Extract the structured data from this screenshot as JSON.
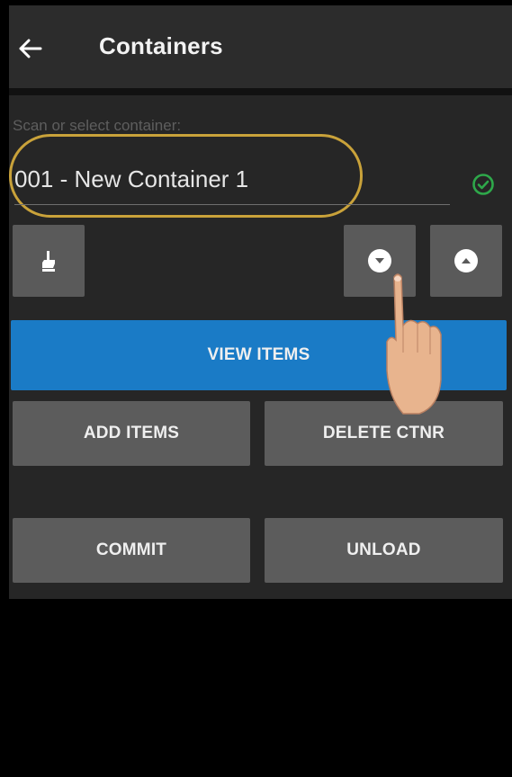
{
  "appbar": {
    "back_icon": "arrow-left-icon",
    "title": "Containers"
  },
  "container_field": {
    "label": "Scan or select container:",
    "value": "001 - New Container 1",
    "status_icon": "check-circle-icon",
    "status_color": "#2ea84a",
    "highlight_color": "#c9a23a"
  },
  "icon_buttons": {
    "hand": "hand-pointer-icon",
    "down": "chevron-down-circle-icon",
    "up": "chevron-up-circle-icon"
  },
  "buttons": {
    "view_items": "VIEW ITEMS",
    "add_items": "ADD ITEMS",
    "delete_ctnr": "DELETE CTNR",
    "commit": "COMMIT",
    "unload": "UNLOAD"
  },
  "colors": {
    "primary_button": "#1a7bc6",
    "secondary_button": "#5c5c5c",
    "appbar": "#2c2c2c",
    "content_bg": "#262626"
  }
}
